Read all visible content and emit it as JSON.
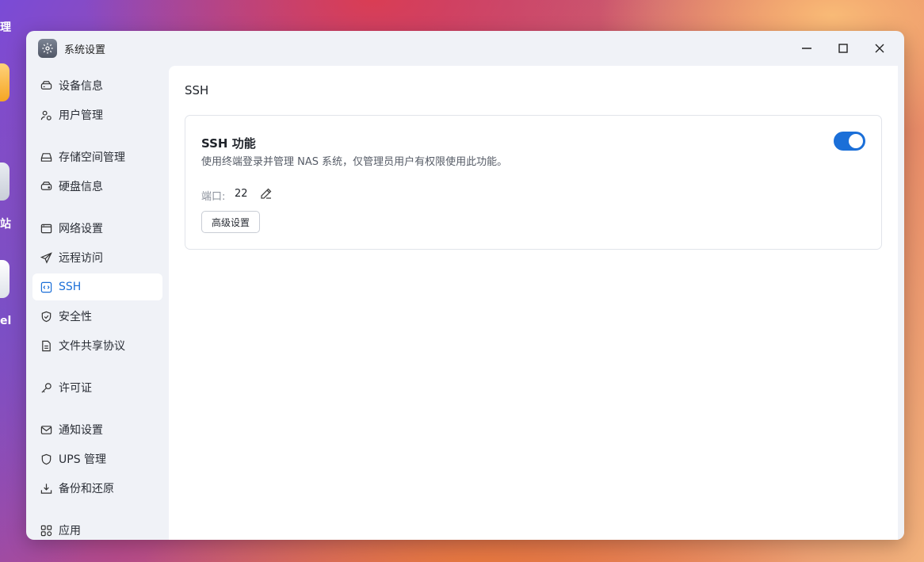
{
  "desktop": {
    "labels": [
      "理",
      "站",
      "el"
    ]
  },
  "window": {
    "title": "系统设置",
    "icon": "gear-icon"
  },
  "sidebar": {
    "items": [
      {
        "label": "设备信息",
        "icon": "device-icon"
      },
      {
        "label": "用户管理",
        "icon": "users-icon"
      },
      {
        "label": "存储空间管理",
        "icon": "storage-icon"
      },
      {
        "label": "硬盘信息",
        "icon": "disk-icon"
      },
      {
        "label": "网络设置",
        "icon": "network-icon"
      },
      {
        "label": "远程访问",
        "icon": "send-icon"
      },
      {
        "label": "SSH",
        "icon": "code-icon",
        "active": true
      },
      {
        "label": "安全性",
        "icon": "shield-check-icon"
      },
      {
        "label": "文件共享协议",
        "icon": "file-icon"
      },
      {
        "label": "许可证",
        "icon": "key-icon"
      },
      {
        "label": "通知设置",
        "icon": "mail-icon"
      },
      {
        "label": "UPS 管理",
        "icon": "shield-icon"
      },
      {
        "label": "备份和还原",
        "icon": "download-icon"
      },
      {
        "label": "应用",
        "icon": "apps-icon"
      }
    ]
  },
  "main": {
    "section_title": "SSH",
    "card": {
      "title": "SSH 功能",
      "description": "使用终端登录并管理 NAS 系统，仅管理员用户有权限使用此功能。",
      "enabled": true,
      "port_label": "端口:",
      "port_value": "22",
      "advanced_button": "高级设置"
    }
  },
  "colors": {
    "accent": "#1b6fd8",
    "window_bg": "#f0f2f7",
    "content_bg": "#ffffff"
  }
}
